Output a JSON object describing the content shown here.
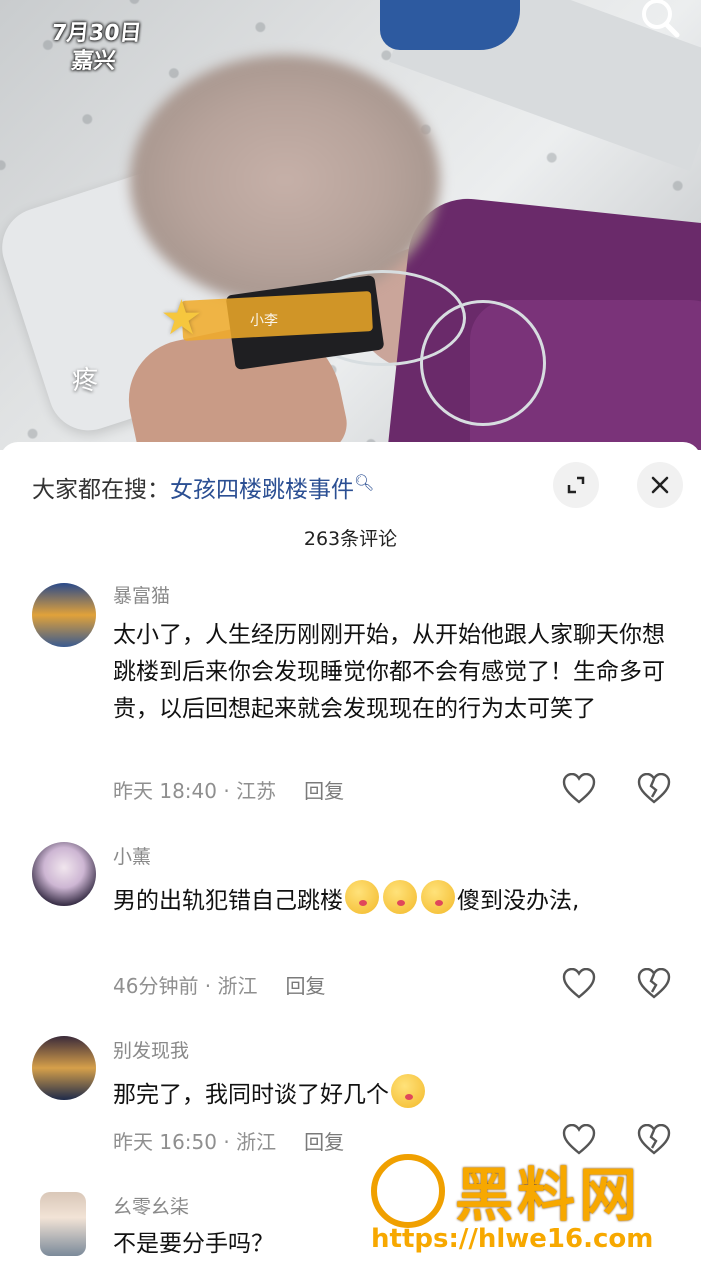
{
  "video": {
    "date": "7月30日",
    "city": "嘉兴",
    "sticker_name": "小李",
    "overlay_word": "疼"
  },
  "sheet": {
    "search_prefix": "大家都在搜：",
    "search_term": "女孩四楼跳楼事件",
    "comment_count": "263条评论"
  },
  "comments": [
    {
      "user": "暴富猫",
      "text": "太小了，人生经历刚刚开始，从开始他跟人家聊天你想跳楼到后来你会发现睡觉你都不会有感觉了！生命多可贵，以后回想起来就会发现现在的行为太可笑了",
      "time": "昨天 18:40",
      "location": "江苏",
      "reply": "回复"
    },
    {
      "user": "小薰",
      "text_before": "男的出轨犯错自己跳楼",
      "text_after": "傻到没办法,",
      "time": "46分钟前",
      "location": "浙江",
      "reply": "回复"
    },
    {
      "user": "别发现我",
      "text": "那完了，我同时谈了好几个",
      "time": "昨天 16:50",
      "location": "浙江",
      "reply": "回复"
    },
    {
      "user": "幺零幺柒",
      "text": "不是要分手吗？"
    }
  ],
  "watermark": {
    "title": "黑料网",
    "url": "https://hlwe16.com"
  },
  "icons": {
    "search": "search-icon",
    "expand": "expand-icon",
    "close": "close-icon",
    "like": "heart-icon",
    "dislike": "broken-heart-icon"
  }
}
